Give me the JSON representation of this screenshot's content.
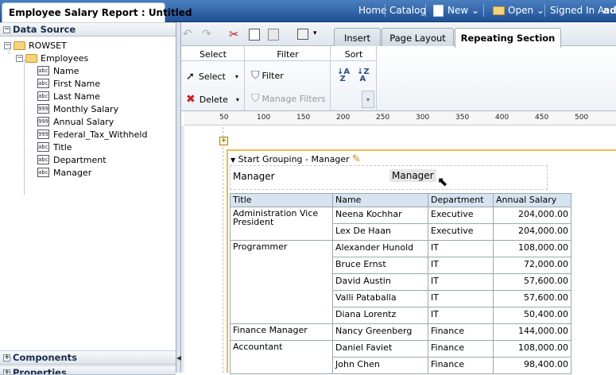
{
  "header": {
    "title": "Employee Salary Report : Untitled",
    "links": [
      "Home",
      "Catalog"
    ],
    "new_label": "New",
    "open_label": "Open",
    "signed_in": "Signed In As",
    "user": "ad"
  },
  "left_panel": {
    "data_source_title": "Data Source",
    "tree": {
      "root": "ROWSET",
      "group": "Employees",
      "fields": [
        {
          "label": "Name",
          "type": "abc"
        },
        {
          "label": "First Name",
          "type": "abc"
        },
        {
          "label": "Last Name",
          "type": "abc"
        },
        {
          "label": "Monthly Salary",
          "type": "999"
        },
        {
          "label": "Annual Salary",
          "type": "999"
        },
        {
          "label": "Federal_Tax_Withheld",
          "type": "999"
        },
        {
          "label": "Title",
          "type": "abc"
        },
        {
          "label": "Department",
          "type": "abc"
        },
        {
          "label": "Manager",
          "type": "abc"
        }
      ]
    },
    "components_title": "Components",
    "properties_title": "Properties"
  },
  "tabs": [
    {
      "label": "Insert",
      "active": false
    },
    {
      "label": "Page Layout",
      "active": false
    },
    {
      "label": "Repeating Section",
      "active": true
    }
  ],
  "ribbon": {
    "select_group": "Select",
    "select_label": "Select",
    "delete_label": "Delete",
    "filter_group": "Filter",
    "filter_label": "Filter",
    "manage_filters_label": "Manage Filters",
    "sort_group": "Sort"
  },
  "ruler": [
    "50",
    "100",
    "150",
    "200",
    "250",
    "300",
    "350",
    "400",
    "450",
    "500"
  ],
  "report": {
    "grouping_label": "Start Grouping - Manager",
    "manager_label": "Manager",
    "manager_field": "Manager",
    "columns": [
      "Title",
      "Name",
      "Department",
      "Annual Salary"
    ],
    "groups": [
      {
        "title": "Administration Vice President",
        "rows": [
          {
            "name": "Neena Kochhar",
            "dept": "Executive",
            "salary": "204,000.00"
          },
          {
            "name": "Lex De Haan",
            "dept": "Executive",
            "salary": "204,000.00"
          }
        ]
      },
      {
        "title": "Programmer",
        "rows": [
          {
            "name": "Alexander Hunold",
            "dept": "IT",
            "salary": "108,000.00"
          },
          {
            "name": "Bruce Ernst",
            "dept": "IT",
            "salary": "72,000.00"
          },
          {
            "name": "David Austin",
            "dept": "IT",
            "salary": "57,600.00"
          },
          {
            "name": "Valli Pataballa",
            "dept": "IT",
            "salary": "57,600.00"
          },
          {
            "name": "Diana Lorentz",
            "dept": "IT",
            "salary": "50,400.00"
          }
        ]
      },
      {
        "title": "Finance Manager",
        "rows": [
          {
            "name": "Nancy Greenberg",
            "dept": "Finance",
            "salary": "144,000.00"
          }
        ]
      },
      {
        "title": "Accountant",
        "rows": [
          {
            "name": "Daniel Faviet",
            "dept": "Finance",
            "salary": "108,000.00"
          },
          {
            "name": "John Chen",
            "dept": "Finance",
            "salary": "98,400.00"
          }
        ]
      }
    ]
  }
}
